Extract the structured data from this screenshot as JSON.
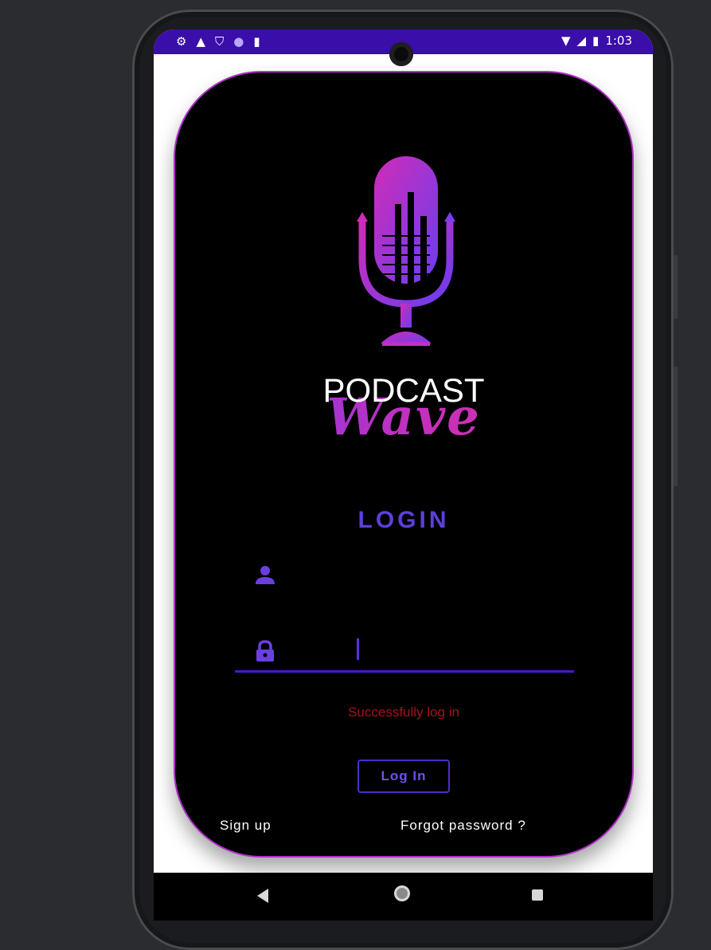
{
  "status_bar": {
    "time": "1:03",
    "left_icons": [
      "gear-icon",
      "warning-icon",
      "shield-icon",
      "circle-icon",
      "sd-card-icon"
    ],
    "right_icons": [
      "wifi-icon",
      "signal-icon",
      "battery-icon"
    ],
    "color": "#3a0ea8"
  },
  "brand": {
    "line1": "PODCAST",
    "line2": "Wave",
    "gradient": [
      "#6b3df0",
      "#c130c0",
      "#e1329b"
    ]
  },
  "login": {
    "title": "LOGIN",
    "username_value": "",
    "password_value": "",
    "message": "Successfully log in",
    "button_label": "Log In",
    "signup_label": "Sign up",
    "forgot_label": "Forgot password ?",
    "accent_color": "#5e3fd8",
    "message_color": "#a3131a"
  },
  "nav_bar": {
    "icons": [
      "back-icon",
      "home-icon",
      "recents-icon"
    ]
  }
}
